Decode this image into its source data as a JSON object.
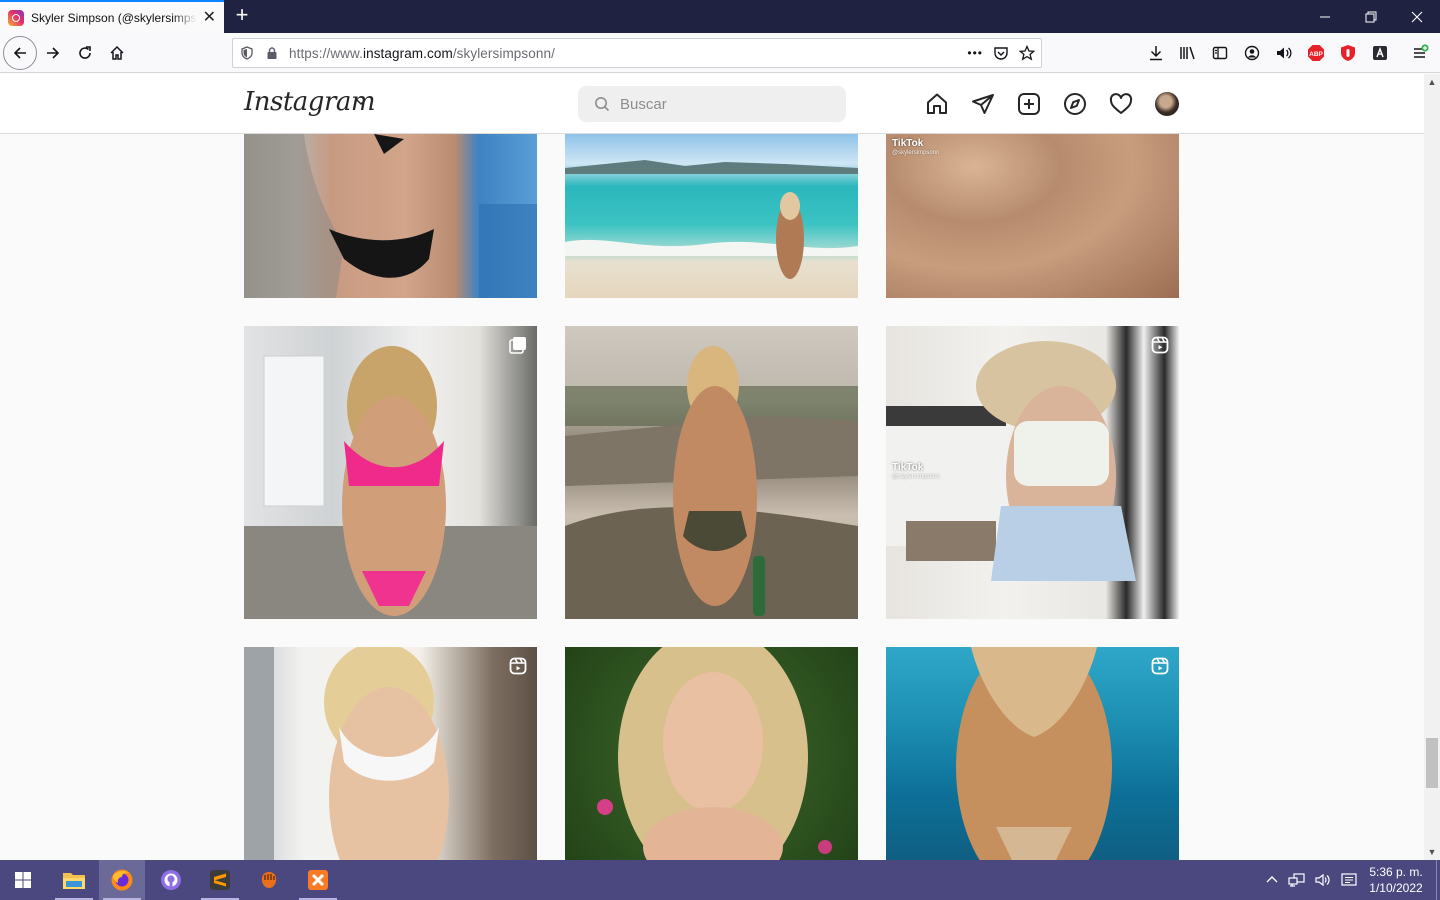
{
  "browser": {
    "tab_title": "Skyler Simpson (@skylersimpsonn) • Instagram photos and videos",
    "tab_close": "✕",
    "new_tab": "+",
    "url_prefix": "https://www.",
    "url_domain": "instagram.com",
    "url_path": "/skylersimpsonn/",
    "more_actions": "•••"
  },
  "instagram": {
    "logo": "Instagram",
    "search_placeholder": "Buscar"
  },
  "grid": [
    {
      "row": 1,
      "col": 1,
      "badge": "none",
      "tiktok": false
    },
    {
      "row": 1,
      "col": 2,
      "badge": "none",
      "tiktok": false
    },
    {
      "row": 1,
      "col": 3,
      "badge": "none",
      "tiktok": true
    },
    {
      "row": 2,
      "col": 1,
      "badge": "multi",
      "tiktok": false
    },
    {
      "row": 2,
      "col": 2,
      "badge": "none",
      "tiktok": false
    },
    {
      "row": 2,
      "col": 3,
      "badge": "reel",
      "tiktok": true
    },
    {
      "row": 3,
      "col": 1,
      "badge": "reel",
      "tiktok": false
    },
    {
      "row": 3,
      "col": 2,
      "badge": "none",
      "tiktok": false
    },
    {
      "row": 3,
      "col": 3,
      "badge": "reel",
      "tiktok": false
    }
  ],
  "tiktok": {
    "label": "TikTok",
    "handle": "@skylersimpsonn"
  },
  "taskbar": {
    "time": "5:36 p. m.",
    "date": "1/10/2022"
  },
  "colors": {
    "tabstrip": "#1f2240",
    "taskbar": "#4b4880",
    "accent": "#0a84ff",
    "adblock": "#e8202a"
  }
}
